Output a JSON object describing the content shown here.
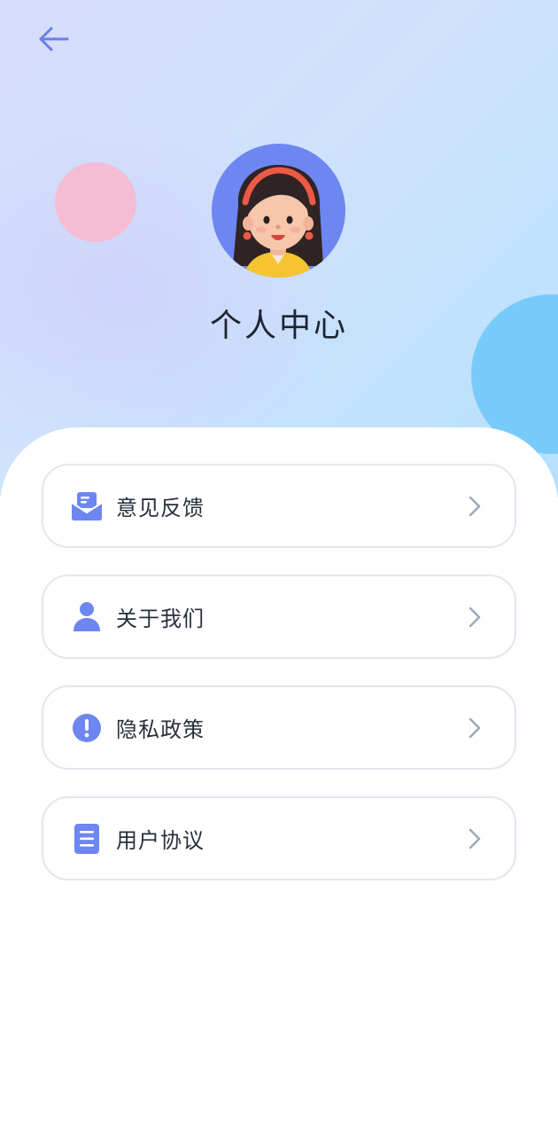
{
  "header": {
    "back_icon": "arrow-left-icon",
    "title": "个人中心"
  },
  "profile": {
    "avatar_icon": "girl-avatar",
    "avatar_bg_color": "#6d86f2"
  },
  "colors": {
    "accent": "#6d86f2",
    "pink_bubble": "#f4bdd4",
    "blue_bubble": "#78cbf8",
    "text": "#1e2433"
  },
  "menu": {
    "items": [
      {
        "label": "意见反馈",
        "icon": "feedback-mail-icon"
      },
      {
        "label": "关于我们",
        "icon": "user-icon"
      },
      {
        "label": "隐私政策",
        "icon": "exclamation-icon"
      },
      {
        "label": "用户协议",
        "icon": "document-icon"
      }
    ]
  }
}
